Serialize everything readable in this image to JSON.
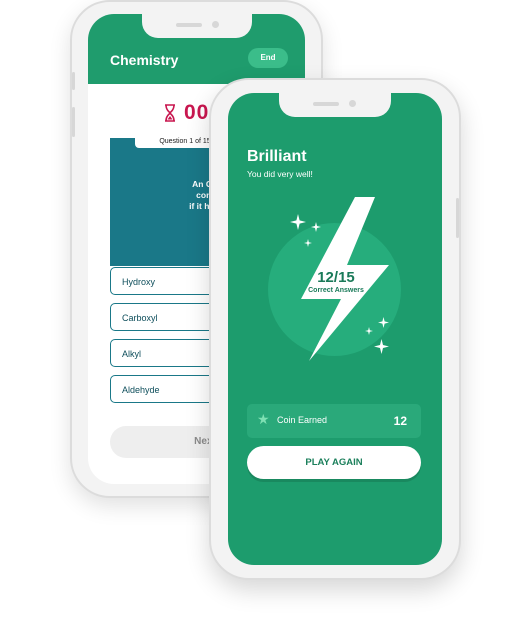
{
  "back_phone": {
    "header_title": "Chemistry",
    "end_button": "End",
    "timer": "00:",
    "question_counter": "Question 1 of 15",
    "question_lines": [
      "An Organic com",
      "considered an",
      "if it has what func"
    ],
    "options": [
      "Hydroxy",
      "Carboxyl",
      "Alkyl",
      "Aldehyde"
    ],
    "next_button": "Next"
  },
  "front_phone": {
    "title": "Brilliant",
    "subtitle": "You did very well!",
    "score": "12/15",
    "score_label": "Correct Answers",
    "coin_label": "Coin Earned",
    "coin_value": "12",
    "play_again": "PLAY AGAIN"
  },
  "colors": {
    "green": "#1d9c6d",
    "teal": "#1a7888",
    "timer_red": "#c8164f",
    "light_green": "#26ad7c"
  },
  "icons": [
    "hourglass-icon",
    "lightning-bolt-icon",
    "sparkle-icon",
    "star-icon"
  ]
}
